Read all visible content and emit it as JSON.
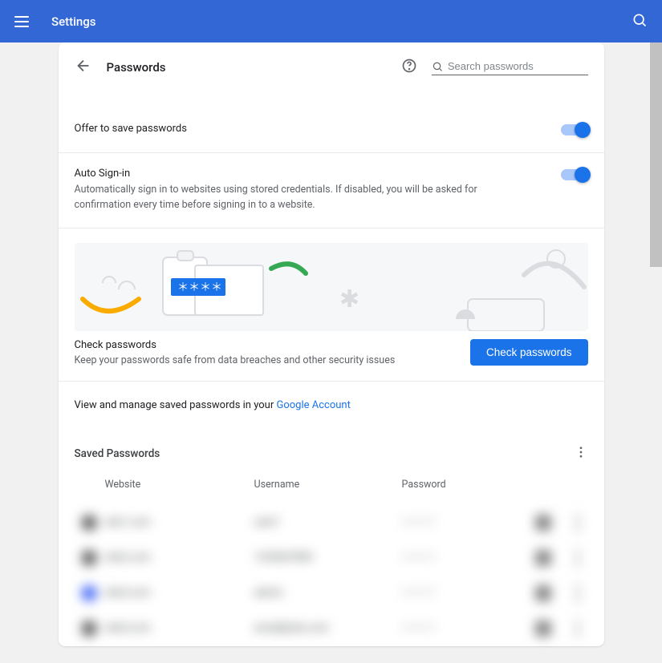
{
  "topbar": {
    "title": "Settings"
  },
  "page": {
    "title": "Passwords"
  },
  "search": {
    "placeholder": "Search passwords"
  },
  "offer_save": {
    "title": "Offer to save passwords"
  },
  "auto_signin": {
    "title": "Auto Sign-in",
    "desc": "Automatically sign in to websites using stored credentials. If disabled, you will be asked for confirmation every time before signing in to a website."
  },
  "check": {
    "title": "Check passwords",
    "desc": "Keep your passwords safe from data breaches and other security issues",
    "button": "Check passwords"
  },
  "google_account": {
    "prefix": "View and manage saved passwords in your ",
    "link": "Google Account"
  },
  "saved": {
    "title": "Saved Passwords"
  },
  "columns": {
    "website": "Website",
    "username": "Username",
    "password": "Password"
  },
  "rows": [
    {
      "site": "site1.com",
      "user": "user1",
      "pw": "••••••••"
    },
    {
      "site": "site2.com",
      "user": "1234567890",
      "pw": "••••••••"
    },
    {
      "site": "site3.com",
      "user": "admin",
      "pw": "••••••••"
    },
    {
      "site": "site4.com",
      "user": "email@site.com",
      "pw": "••••••••"
    }
  ]
}
